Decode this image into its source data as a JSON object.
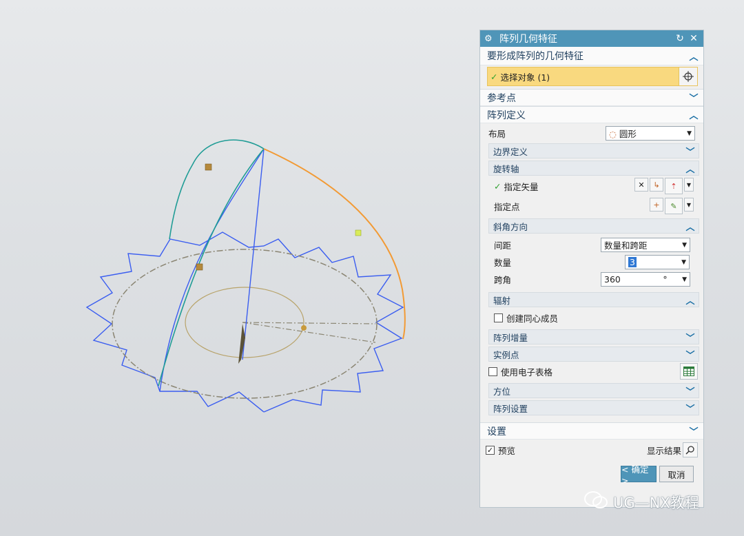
{
  "dialog": {
    "title": "阵列几何特征",
    "icons": {
      "gear": "gear-icon",
      "reset": "reset-icon",
      "close": "close-icon"
    },
    "section_geometry": {
      "title": "要形成阵列的几何特征",
      "select_label": "选择对象 (1)"
    },
    "section_reference": {
      "title": "参考点"
    },
    "section_definition": {
      "title": "阵列定义",
      "layout_label": "布局",
      "layout_value": "圆形",
      "boundary": {
        "title": "边界定义"
      },
      "rotation_axis": {
        "title": "旋转轴",
        "vector_label": "指定矢量",
        "point_label": "指定点"
      },
      "bevel": {
        "title": "斜角方向",
        "spacing_label": "间距",
        "spacing_value": "数量和跨距",
        "count_label": "数量",
        "count_value": "3",
        "span_label": "跨角",
        "span_value": "360",
        "span_unit": "°"
      },
      "radial": {
        "title": "辐射",
        "concentric_label": "创建同心成员"
      },
      "increment": {
        "title": "阵列增量"
      },
      "instance_point": {
        "title": "实例点"
      },
      "spreadsheet_label": "使用电子表格",
      "orientation": {
        "title": "方位"
      },
      "settings": {
        "title": "阵列设置"
      }
    },
    "section_settings": {
      "title": "设置"
    },
    "preview_label": "预览",
    "show_result_label": "显示结果",
    "ok_label": "< 确定 >",
    "cancel_label": "取消",
    "colors": {
      "title_bar": "#4f95b8",
      "selection": "#f9d97f",
      "accent": "#1b6fa5"
    }
  },
  "watermark": {
    "text": "UG—NX教程"
  }
}
